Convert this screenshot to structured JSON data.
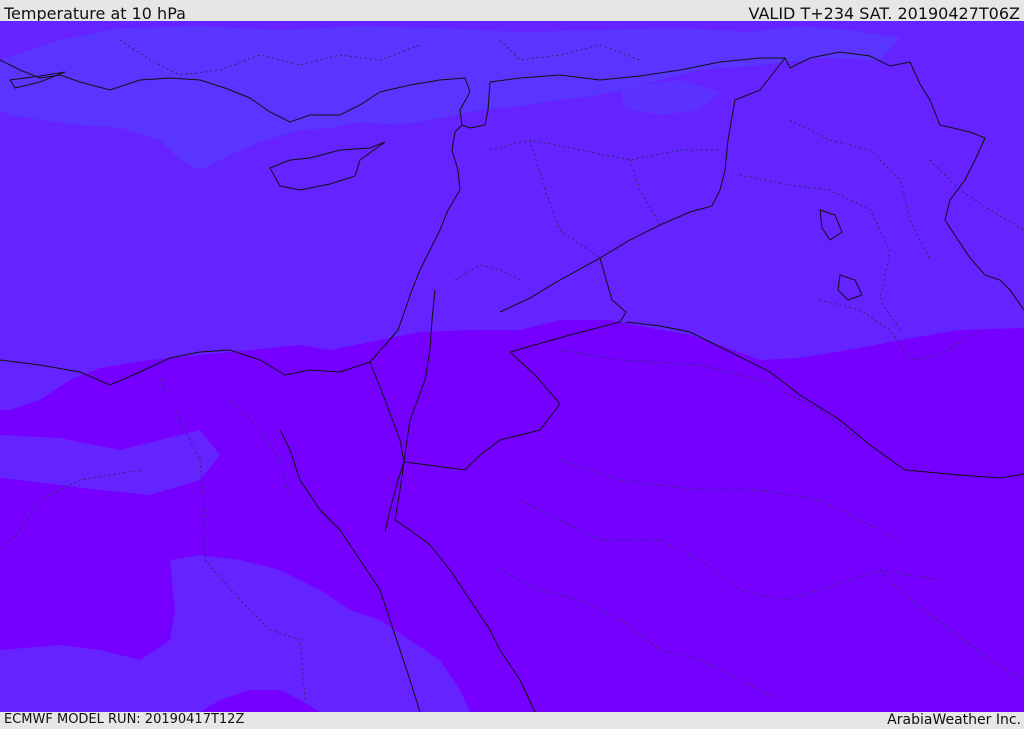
{
  "header": {
    "title": "Temperature at 10 hPa",
    "valid_time": "VALID T+234 SAT. 20190427T06Z"
  },
  "footer": {
    "model_run": "ECMWF MODEL RUN: 20190417T12Z",
    "brand": "ArabiaWeather Inc."
  },
  "map": {
    "colors": {
      "warm_band": "#7600ff",
      "cool_band": "#6423ff",
      "mid_band": "#5a34ff",
      "border": "#111111",
      "admin_border": "#2a2a60"
    }
  }
}
